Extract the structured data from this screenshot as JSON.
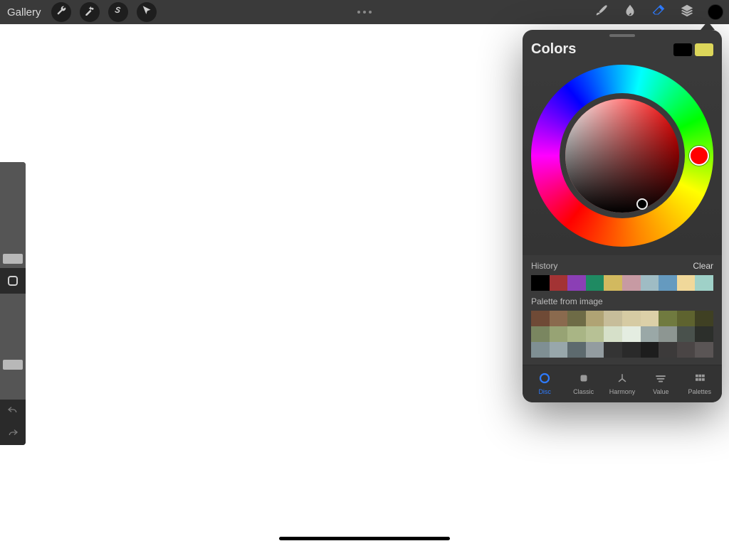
{
  "topbar": {
    "gallery_label": "Gallery"
  },
  "color_panel": {
    "title": "Colors",
    "primary_swatch": "#000000",
    "secondary_swatch": "#dcd65a",
    "history_label": "History",
    "clear_label": "Clear",
    "palette_label": "Palette from image",
    "history_colors": [
      "#000000",
      "#a33334",
      "#8b3fb5",
      "#1f8a62",
      "#d2b95f",
      "#c79aa3",
      "#9fbcc4",
      "#659abf",
      "#f0d89a",
      "#9fd1c8"
    ],
    "palette_colors": [
      "#6f4a36",
      "#8a6a4e",
      "#6e6b46",
      "#b0a374",
      "#c7bd9a",
      "#d6cba3",
      "#dcd0a8",
      "#707a3f",
      "#5e632f",
      "#3f4023",
      "#7a8660",
      "#97a374",
      "#a9b585",
      "#b7c195",
      "#d6e0c9",
      "#e4ede1",
      "#9aa8a7",
      "#8d9692",
      "#49514c",
      "#2c2f2b",
      "#7f8f93",
      "#98a7ab",
      "#5d6a6e",
      "#939ca0",
      "#343434",
      "#2a2a2a",
      "#1d1d1d",
      "#3c3a3a",
      "#4a4545",
      "#5a5555"
    ],
    "tabs": {
      "disc": "Disc",
      "classic": "Classic",
      "harmony": "Harmony",
      "value": "Value",
      "palettes": "Palettes"
    }
  }
}
